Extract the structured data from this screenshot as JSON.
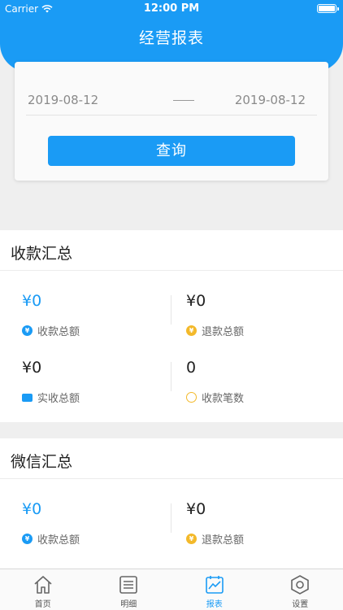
{
  "status_bar": {
    "carrier": "Carrier",
    "time": "12:00 PM"
  },
  "header": {
    "title": "经营报表"
  },
  "filter": {
    "start_date": "2019-08-12",
    "end_date": "2019-08-12",
    "query_button": "查询"
  },
  "sections": [
    {
      "title": "收款汇总",
      "items": [
        {
          "amount": "¥0",
          "label": "收款总额",
          "icon": "yen-icon"
        },
        {
          "amount": "¥0",
          "label": "退款总额",
          "icon": "refund-icon"
        },
        {
          "amount": "¥0",
          "label": "实收总额",
          "icon": "wallet-icon"
        },
        {
          "amount": "0",
          "label": "收款笔数",
          "icon": "count-icon"
        }
      ]
    },
    {
      "title": "微信汇总",
      "items": [
        {
          "amount": "¥0",
          "label": "收款总额",
          "icon": "yen-icon"
        },
        {
          "amount": "¥0",
          "label": "退款总额",
          "icon": "refund-icon"
        }
      ]
    }
  ],
  "tabbar": [
    {
      "label": "首页",
      "icon": "home-icon"
    },
    {
      "label": "明细",
      "icon": "list-icon"
    },
    {
      "label": "报表",
      "icon": "chart-icon",
      "active": true
    },
    {
      "label": "设置",
      "icon": "settings-icon"
    }
  ],
  "colors": {
    "accent": "#1a9bf5",
    "refund": "#f3b92a",
    "background": "#efefef"
  }
}
